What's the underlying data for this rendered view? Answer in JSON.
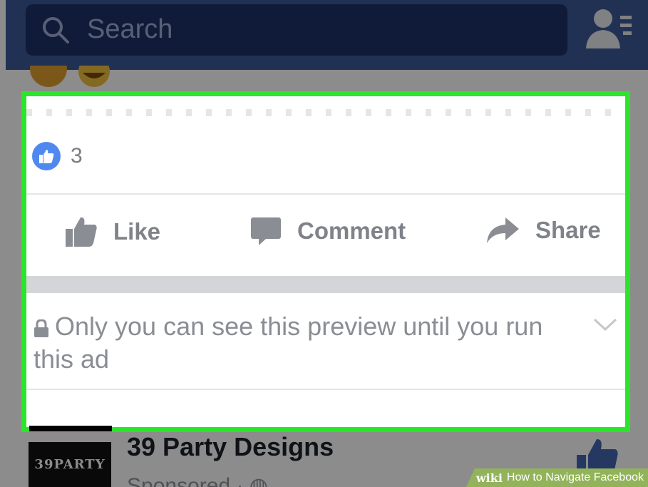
{
  "header": {
    "search_placeholder": "Search"
  },
  "post": {
    "reaction_count": "3",
    "actions": {
      "like": "Like",
      "comment": "Comment",
      "share": "Share"
    },
    "privacy_notice": "Only you can see this preview until you run this ad"
  },
  "next_post": {
    "logo_text": "39PARTY",
    "page_name": "39 Party Designs",
    "sponsored": "Sponsored · "
  },
  "watermark": {
    "brand": "wiki",
    "title": "How to Navigate Facebook"
  },
  "colors": {
    "highlight": "#2be52b",
    "facebook_blue": "#3b5998",
    "like_blue": "#4f89f0"
  }
}
